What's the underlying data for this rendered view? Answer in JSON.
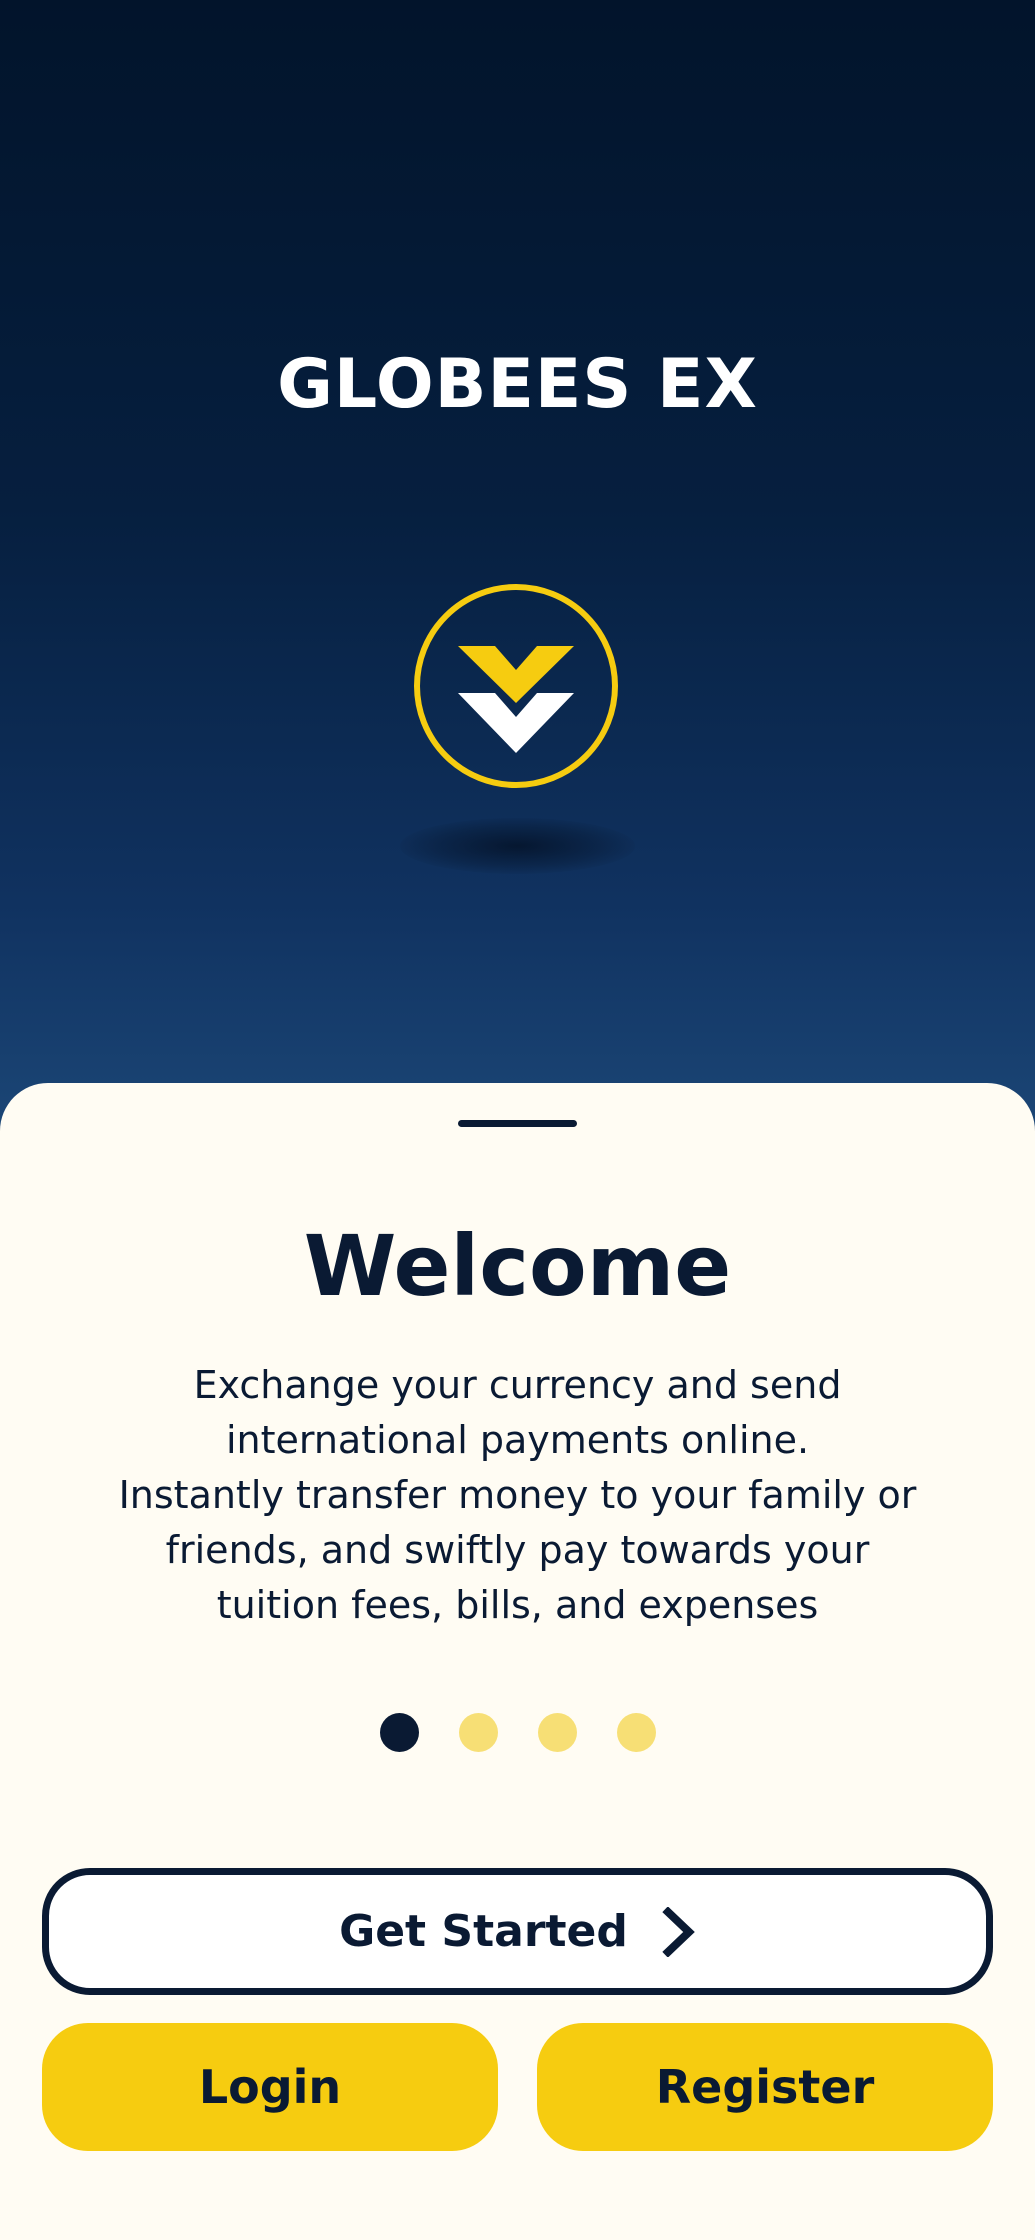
{
  "app": {
    "title": "GLOBEES EX",
    "logo_icon": "globees-logo-icon",
    "colors": {
      "hero_top": "#02142b",
      "hero_bottom": "#1b4676",
      "accent_yellow": "#f6cc10",
      "navy": "#0a1a33",
      "sheet_background": "#fffcf3"
    }
  },
  "onboarding": {
    "heading": "Welcome",
    "description": "Exchange your currency and send\ninternational payments online.\nInstantly transfer money to your family or\nfriends, and swiftly pay towards your\ntuition fees, bills, and expenses",
    "pagination": {
      "total": 4,
      "active": 1
    }
  },
  "actions": {
    "get_started_label": "Get Started",
    "get_started_icon": "chevron-right-icon",
    "login_label": "Login",
    "register_label": "Register"
  }
}
